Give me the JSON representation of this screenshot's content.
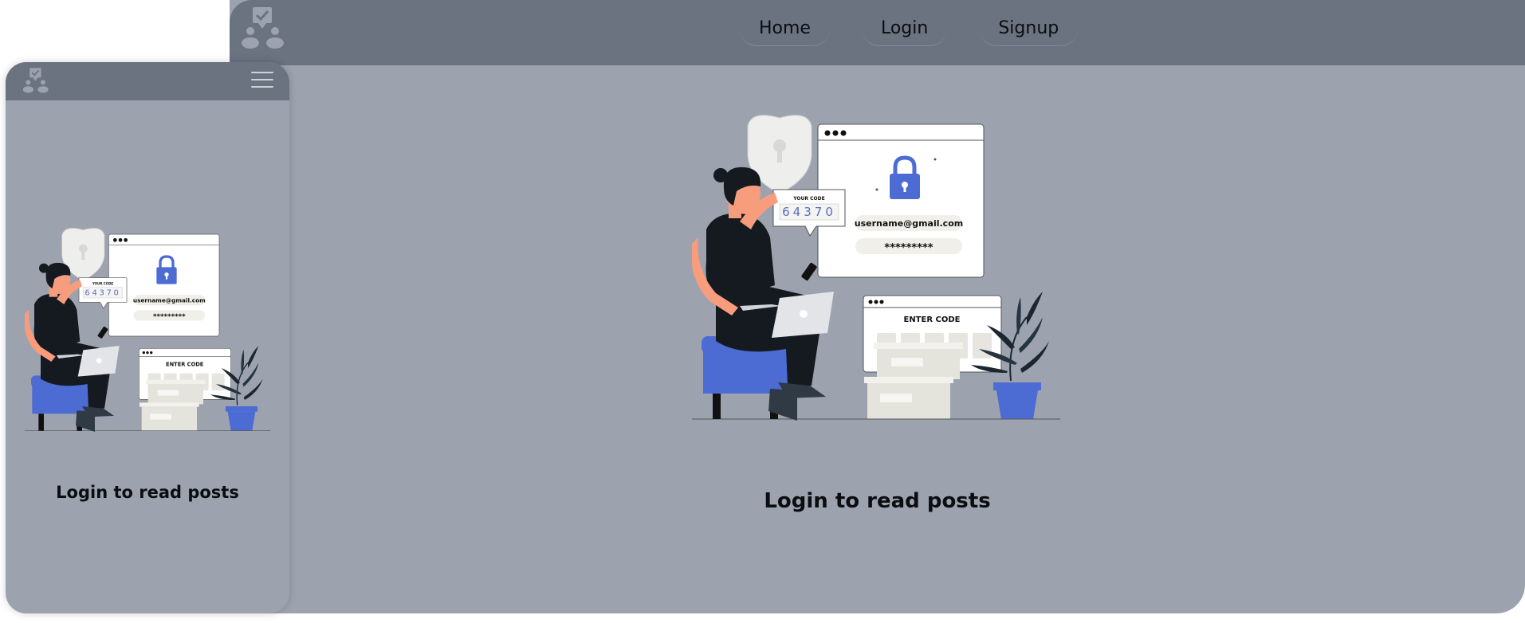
{
  "desktop": {
    "nav": {
      "home": "Home",
      "login": "Login",
      "signup": "Signup"
    },
    "caption": "Login to read posts"
  },
  "mobile": {
    "caption": "Login to read posts"
  },
  "illustration": {
    "your_code_label": "YOUR CODE",
    "code": "64370",
    "email": "username@gmail.com",
    "password": "*********",
    "enter_code_label": "ENTER CODE"
  },
  "colors": {
    "topbar": "#6b7280",
    "body": "#9ca3af",
    "accent": "#4c6bd3"
  },
  "icons": [
    "app-logo-icon",
    "hamburger-menu-icon",
    "padlock-icon",
    "shield-icon"
  ]
}
